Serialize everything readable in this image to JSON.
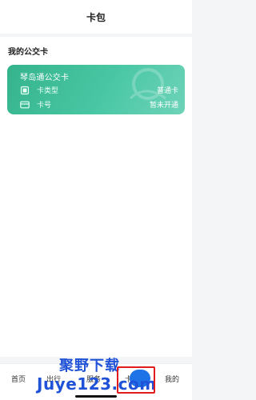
{
  "header": {
    "title": "卡包"
  },
  "section": {
    "title": "我的公交卡"
  },
  "card": {
    "name": "琴岛通公交卡",
    "rows": [
      {
        "icon": "card-type-icon",
        "label": "卡类型",
        "value": "普通卡"
      },
      {
        "icon": "card-number-icon",
        "label": "卡号",
        "value": "暂未开通"
      }
    ],
    "colors": {
      "gradient_start": "#34b38b",
      "gradient_end": "#6ed3b8"
    }
  },
  "tabbar": {
    "items": [
      {
        "label": "首页"
      },
      {
        "label": "出行"
      },
      {
        "label": "服务"
      },
      {
        "label": "卡包"
      },
      {
        "label": "我的"
      }
    ],
    "active_color": "#1e73e6"
  },
  "watermark": {
    "line1": "聚野下载",
    "line2": "Juye123.com"
  }
}
